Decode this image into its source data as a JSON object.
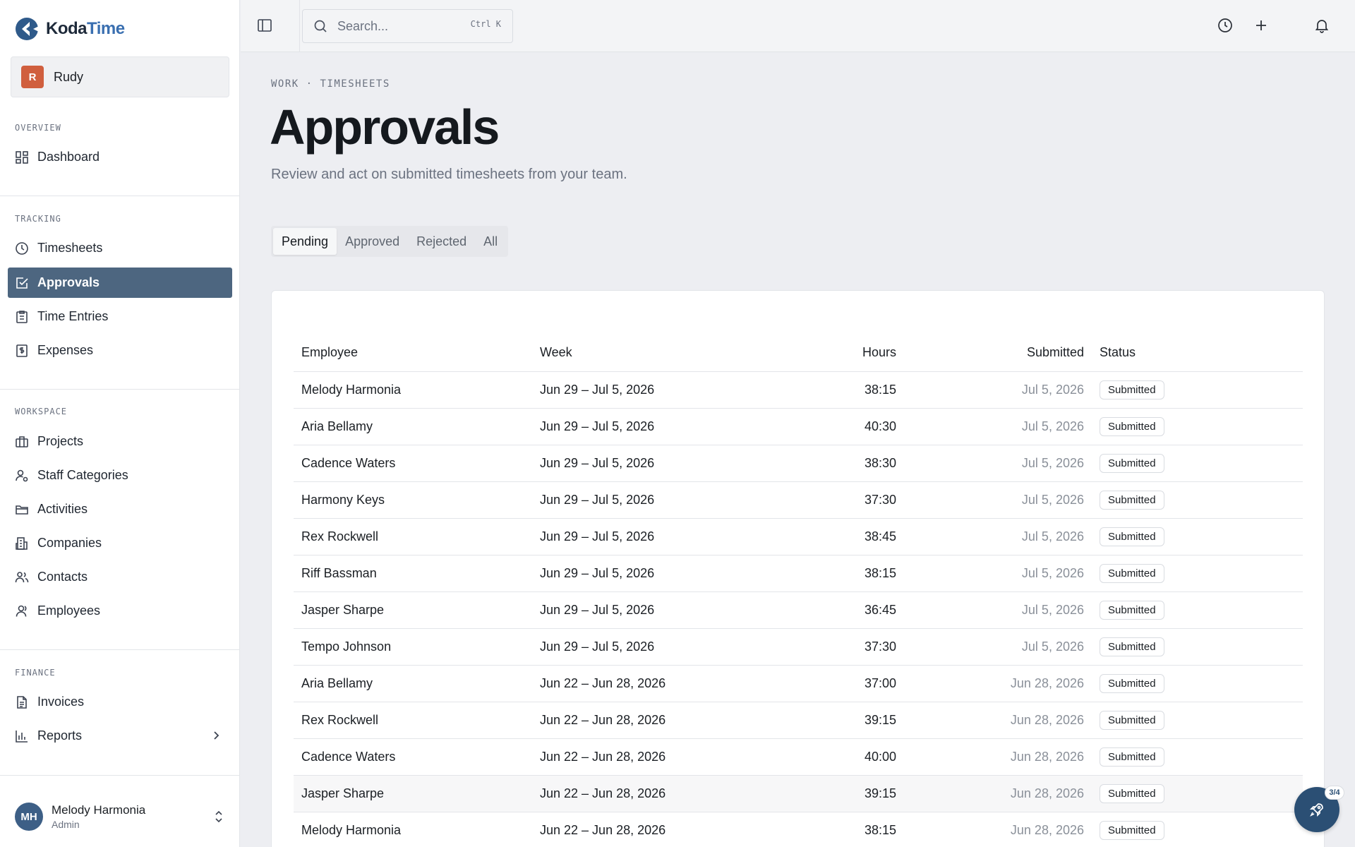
{
  "app": {
    "name_part1": "Koda",
    "name_part2": "Time",
    "brand_color": "#3a6fb0"
  },
  "org": {
    "initial": "R",
    "name": "Rudy",
    "color": "#d05f3e"
  },
  "sidebar": {
    "sections": [
      {
        "label": "OVERVIEW",
        "items": [
          {
            "label": "Dashboard",
            "icon": "dashboard-icon"
          }
        ]
      },
      {
        "label": "TRACKING",
        "items": [
          {
            "label": "Timesheets",
            "icon": "clock-icon"
          },
          {
            "label": "Approvals",
            "icon": "check-square-icon",
            "active": true
          },
          {
            "label": "Time Entries",
            "icon": "clipboard-icon"
          },
          {
            "label": "Expenses",
            "icon": "receipt-icon"
          }
        ]
      },
      {
        "label": "WORKSPACE",
        "items": [
          {
            "label": "Projects",
            "icon": "briefcase-icon"
          },
          {
            "label": "Staff Categories",
            "icon": "user-settings-icon"
          },
          {
            "label": "Activities",
            "icon": "folder-icon"
          },
          {
            "label": "Companies",
            "icon": "building-icon"
          },
          {
            "label": "Contacts",
            "icon": "users-icon"
          },
          {
            "label": "Employees",
            "icon": "user-icon"
          }
        ]
      },
      {
        "label": "FINANCE",
        "items": [
          {
            "label": "Invoices",
            "icon": "document-icon"
          },
          {
            "label": "Reports",
            "icon": "bar-chart-icon"
          }
        ]
      }
    ],
    "active_color": "#4d6680"
  },
  "user": {
    "initials": "MH",
    "name": "Melody Harmonia",
    "role": "Admin"
  },
  "topbar": {
    "search_placeholder": "Search...",
    "search_shortcut": "Ctrl K"
  },
  "page": {
    "breadcrumb": "WORK · TIMESHEETS",
    "title": "Approvals",
    "subtitle": "Review and act on submitted timesheets from your team."
  },
  "tabs": [
    {
      "label": "Pending",
      "active": true
    },
    {
      "label": "Approved"
    },
    {
      "label": "Rejected"
    },
    {
      "label": "All"
    }
  ],
  "table": {
    "columns": [
      "Employee",
      "Week",
      "Hours",
      "Submitted",
      "Status"
    ],
    "rows": [
      [
        "Melody Harmonia",
        "Jun 29 – Jul 5, 2026",
        "38:15",
        "Jul 5, 2026",
        "Submitted"
      ],
      [
        "Aria Bellamy",
        "Jun 29 – Jul 5, 2026",
        "40:30",
        "Jul 5, 2026",
        "Submitted"
      ],
      [
        "Cadence Waters",
        "Jun 29 – Jul 5, 2026",
        "38:30",
        "Jul 5, 2026",
        "Submitted"
      ],
      [
        "Harmony Keys",
        "Jun 29 – Jul 5, 2026",
        "37:30",
        "Jul 5, 2026",
        "Submitted"
      ],
      [
        "Rex Rockwell",
        "Jun 29 – Jul 5, 2026",
        "38:45",
        "Jul 5, 2026",
        "Submitted"
      ],
      [
        "Riff Bassman",
        "Jun 29 – Jul 5, 2026",
        "38:15",
        "Jul 5, 2026",
        "Submitted"
      ],
      [
        "Jasper Sharpe",
        "Jun 29 – Jul 5, 2026",
        "36:45",
        "Jul 5, 2026",
        "Submitted"
      ],
      [
        "Tempo Johnson",
        "Jun 29 – Jul 5, 2026",
        "37:30",
        "Jul 5, 2026",
        "Submitted"
      ],
      [
        "Aria Bellamy",
        "Jun 22 – Jun 28, 2026",
        "37:00",
        "Jun 28, 2026",
        "Submitted"
      ],
      [
        "Rex Rockwell",
        "Jun 22 – Jun 28, 2026",
        "39:15",
        "Jun 28, 2026",
        "Submitted"
      ],
      [
        "Cadence Waters",
        "Jun 22 – Jun 28, 2026",
        "40:00",
        "Jun 28, 2026",
        "Submitted"
      ],
      [
        "Jasper Sharpe",
        "Jun 22 – Jun 28, 2026",
        "39:15",
        "Jun 28, 2026",
        "Submitted"
      ],
      [
        "Melody Harmonia",
        "Jun 22 – Jun 28, 2026",
        "38:15",
        "Jun 28, 2026",
        "Submitted"
      ]
    ],
    "hover_row": 11
  },
  "onboarding": {
    "progress": "3/4",
    "icon": "rocket-icon"
  }
}
